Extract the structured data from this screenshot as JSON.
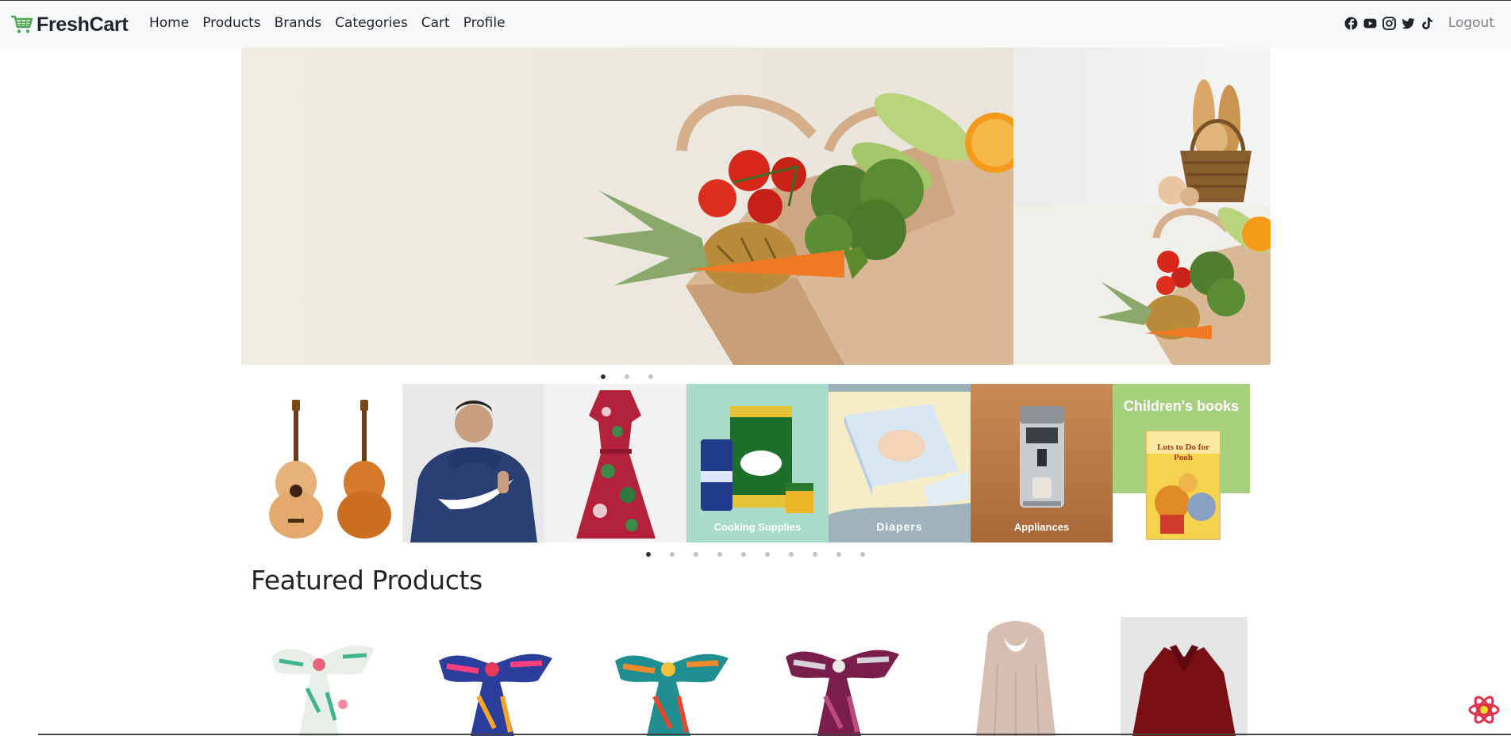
{
  "navbar": {
    "brand": "FreshCart",
    "links": [
      "Home",
      "Products",
      "Brands",
      "Categories",
      "Cart",
      "Profile"
    ],
    "social_icons": [
      "facebook-icon",
      "youtube-icon",
      "instagram-icon",
      "twitter-icon",
      "tiktok-icon"
    ],
    "logout": "Logout"
  },
  "hero": {
    "slide_count": 3,
    "active_slide": 1
  },
  "categories": {
    "tiles": [
      {
        "name": "guitars",
        "caption": ""
      },
      {
        "name": "mens-hoodie",
        "caption": ""
      },
      {
        "name": "dress",
        "caption": ""
      },
      {
        "name": "cooking-supplies",
        "caption": "Cooking Supplies"
      },
      {
        "name": "diapers",
        "caption": "Diapers"
      },
      {
        "name": "appliances",
        "caption": "Appliances"
      },
      {
        "name": "childrens-books",
        "caption": "Children's books"
      }
    ],
    "book_cover_text": "Lots to Do for Pooh",
    "dot_count": 10,
    "active_dot": 1
  },
  "featured": {
    "title": "Featured Products"
  },
  "colors": {
    "brand_green": "#4fa74f",
    "navbar_bg": "#f8f9fa",
    "books_green": "#a6cf7e",
    "appliances_brown": "#c98a55"
  }
}
